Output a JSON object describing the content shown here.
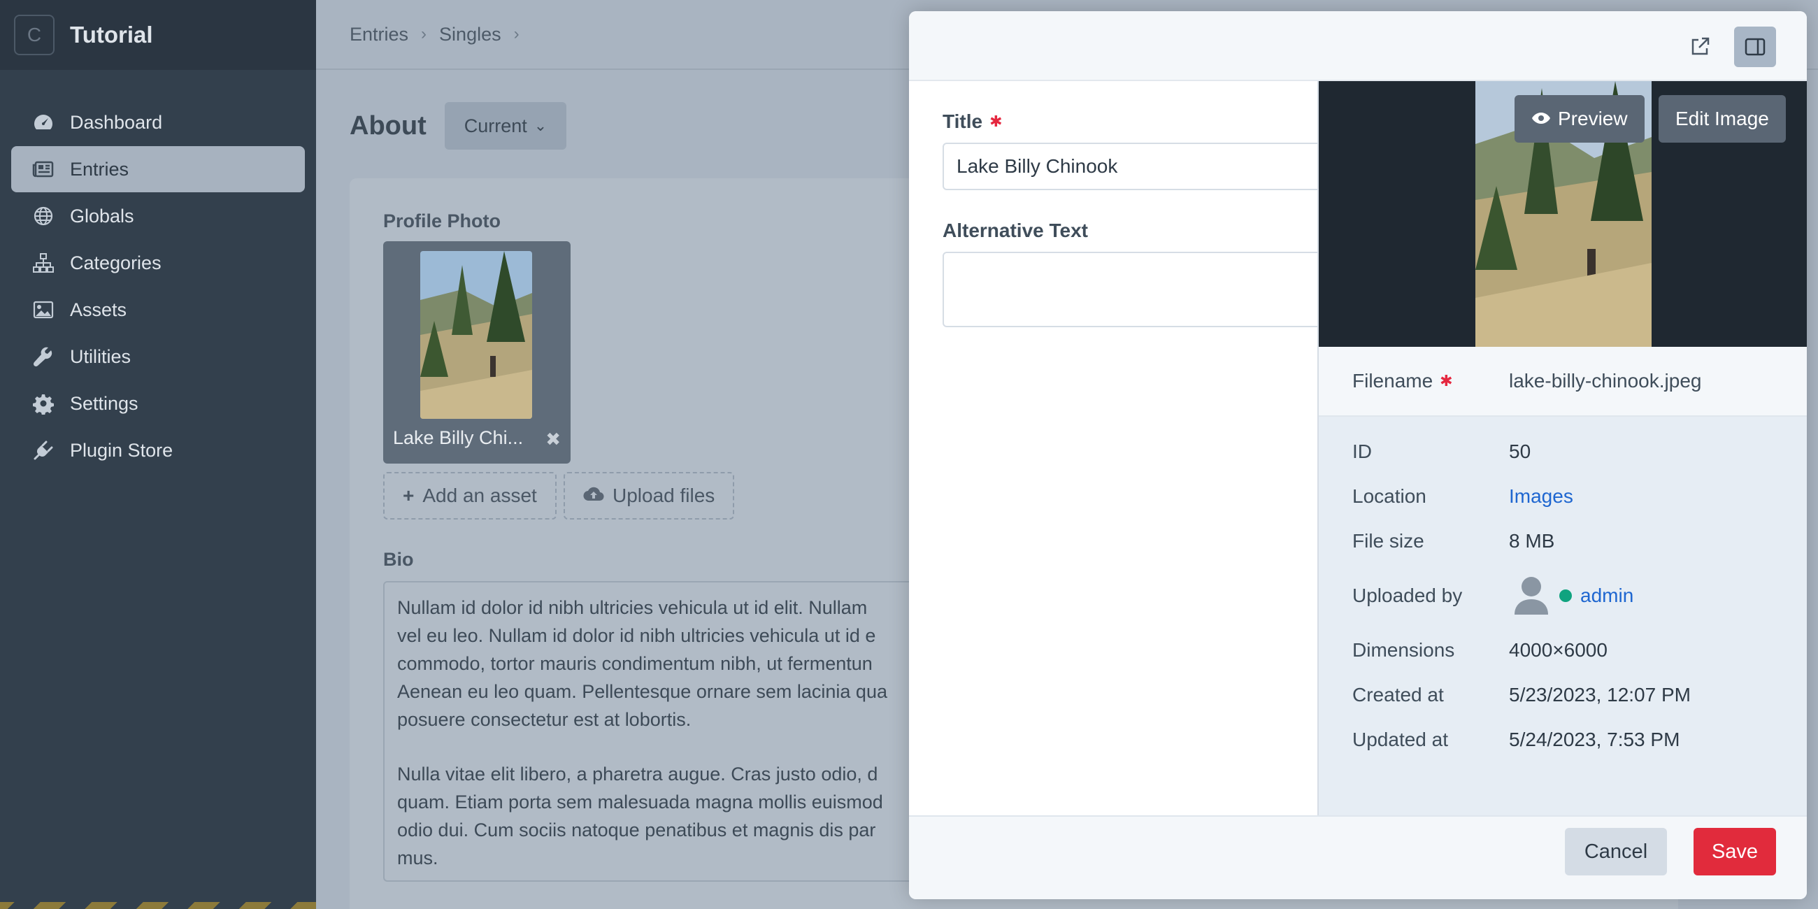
{
  "sidebar": {
    "logo_letter": "C",
    "site_name": "Tutorial",
    "items": [
      {
        "label": "Dashboard",
        "icon": "gauge-icon"
      },
      {
        "label": "Entries",
        "icon": "newspaper-icon",
        "active": true
      },
      {
        "label": "Globals",
        "icon": "globe-icon"
      },
      {
        "label": "Categories",
        "icon": "sitemap-icon"
      },
      {
        "label": "Assets",
        "icon": "image-icon"
      },
      {
        "label": "Utilities",
        "icon": "wrench-icon"
      },
      {
        "label": "Settings",
        "icon": "gear-icon"
      },
      {
        "label": "Plugin Store",
        "icon": "plug-icon"
      }
    ]
  },
  "breadcrumb": [
    "Entries",
    "Singles"
  ],
  "page": {
    "title": "About",
    "site_selector": "Current"
  },
  "entry": {
    "profile_photo_label": "Profile Photo",
    "asset_name": "Lake Billy Chi...",
    "add_asset_label": "Add an asset",
    "upload_files_label": "Upload files",
    "bio_label": "Bio",
    "bio_lines_1": [
      "Nullam id dolor id nibh ultricies vehicula ut id elit. Nullam",
      "vel eu leo. Nullam id dolor id nibh ultricies vehicula ut id e",
      "commodo, tortor mauris condimentum nibh, ut fermentun",
      "Aenean eu leo quam. Pellentesque ornare sem lacinia qua",
      "posuere consectetur est at lobortis."
    ],
    "bio_lines_2": [
      "Nulla vitae elit libero, a pharetra augue. Cras justo odio, d",
      "quam. Etiam porta sem malesuada magna mollis euismod",
      "odio dui. Cum sociis natoque penatibus et magnis dis par",
      "mus."
    ]
  },
  "slideout": {
    "title_label": "Title",
    "title_value": "Lake Billy Chinook",
    "alt_label": "Alternative Text",
    "alt_value": "",
    "preview_label": "Preview",
    "edit_image_label": "Edit Image",
    "filename_label": "Filename",
    "filename_value": "lake-billy-chinook.jpeg",
    "meta": [
      {
        "key": "ID",
        "value": "50"
      },
      {
        "key": "Location",
        "value": "Images",
        "link": true
      },
      {
        "key": "File size",
        "value": "8 MB"
      },
      {
        "key": "Uploaded by",
        "value": "admin",
        "user": true
      },
      {
        "key": "Dimensions",
        "value": "4000×6000"
      },
      {
        "key": "Created at",
        "value": "5/23/2023, 12:07 PM"
      },
      {
        "key": "Updated at",
        "value": "5/24/2023, 7:53 PM"
      }
    ],
    "cancel_label": "Cancel",
    "save_label": "Save"
  },
  "colors": {
    "accent_red": "#e12b3c",
    "link_blue": "#1e66d0",
    "status_online": "#10a37f"
  }
}
